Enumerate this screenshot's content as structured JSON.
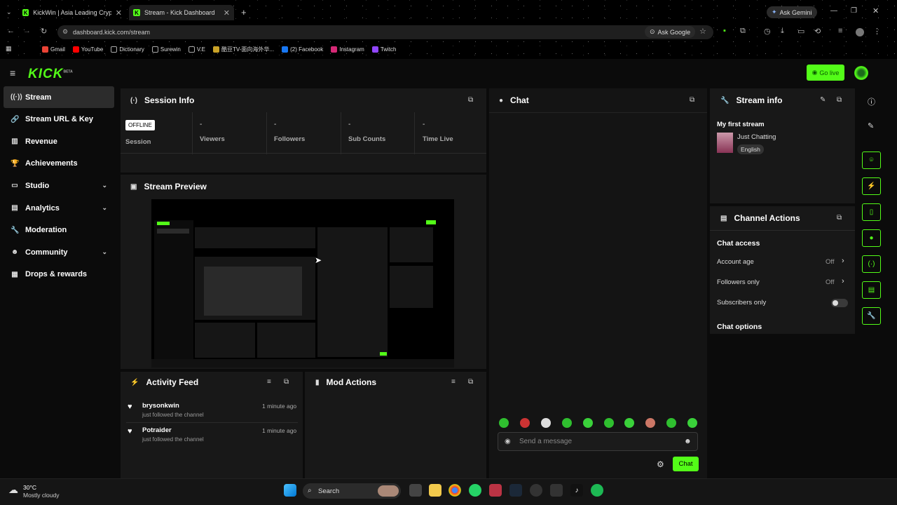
{
  "browser": {
    "tabs": [
      {
        "title": "KickWin | Asia Leading Crypto",
        "active": false
      },
      {
        "title": "Stream - Kick Dashboard",
        "active": true
      }
    ],
    "url": "dashboard.kick.com/stream",
    "ask_google": "Ask Google",
    "ask_gemini": "Ask Gemini",
    "bookmarks": [
      "Gmail",
      "YouTube",
      "Dictionary",
      "Surewin",
      "V.E",
      "酷豆TV-面向海外华...",
      "(2) Facebook",
      "Instagram",
      "Twitch"
    ]
  },
  "header": {
    "logo": "KICK",
    "logo_badge": "BETA",
    "go_live": "Go live"
  },
  "sidebar": {
    "items": [
      {
        "label": "Stream",
        "icon": "broadcast-icon",
        "glyph": "((·))",
        "active": true,
        "chevron": false
      },
      {
        "label": "Stream URL & Key",
        "icon": "link-icon",
        "glyph": "🔗",
        "active": false,
        "chevron": false
      },
      {
        "label": "Revenue",
        "icon": "chart-icon",
        "glyph": "▥",
        "active": false,
        "chevron": false
      },
      {
        "label": "Achievements",
        "icon": "trophy-icon",
        "glyph": "🏆",
        "active": false,
        "chevron": false
      },
      {
        "label": "Studio",
        "icon": "monitor-icon",
        "glyph": "▭",
        "active": false,
        "chevron": true
      },
      {
        "label": "Analytics",
        "icon": "analytics-icon",
        "glyph": "▤",
        "active": false,
        "chevron": true
      },
      {
        "label": "Moderation",
        "icon": "wrench-icon",
        "glyph": "🔧",
        "active": false,
        "chevron": false
      },
      {
        "label": "Community",
        "icon": "community-icon",
        "glyph": "☻",
        "active": false,
        "chevron": true
      },
      {
        "label": "Drops & rewards",
        "icon": "drops-icon",
        "glyph": "▦",
        "active": false,
        "chevron": false
      }
    ]
  },
  "session": {
    "title": "Session Info",
    "status_badge": "OFFLINE",
    "session_label": "Session",
    "stats": [
      {
        "value": "-",
        "label": "Viewers"
      },
      {
        "value": "-",
        "label": "Followers"
      },
      {
        "value": "-",
        "label": "Sub Counts"
      },
      {
        "value": "-",
        "label": "Time Live"
      }
    ]
  },
  "preview": {
    "title": "Stream Preview"
  },
  "activity": {
    "title": "Activity Feed",
    "items": [
      {
        "name": "brysonkwin",
        "action": "just followed the channel",
        "time": "1 minute ago"
      },
      {
        "name": "Potraider",
        "action": "just followed the channel",
        "time": "1 minute ago"
      }
    ]
  },
  "mod_actions": {
    "title": "Mod Actions"
  },
  "chat": {
    "title": "Chat",
    "placeholder": "Send a message",
    "send_label": "Chat"
  },
  "stream_info": {
    "title": "Stream info",
    "stream_title": "My first stream",
    "category": "Just Chatting",
    "language": "English"
  },
  "channel_actions": {
    "title": "Channel Actions",
    "chat_access_heading": "Chat access",
    "rows": [
      {
        "label": "Account age",
        "value": "Off"
      },
      {
        "label": "Followers only",
        "value": "Off"
      }
    ],
    "subscribers_only_label": "Subscribers only",
    "subscribers_only_on": false,
    "chat_options_heading": "Chat options"
  },
  "taskbar": {
    "weather_temp": "30°C",
    "weather_desc": "Mostly cloudy",
    "search_label": "Search"
  },
  "colors": {
    "accent": "#53fc18",
    "panel": "#181818",
    "background": "#0b0b0b"
  }
}
